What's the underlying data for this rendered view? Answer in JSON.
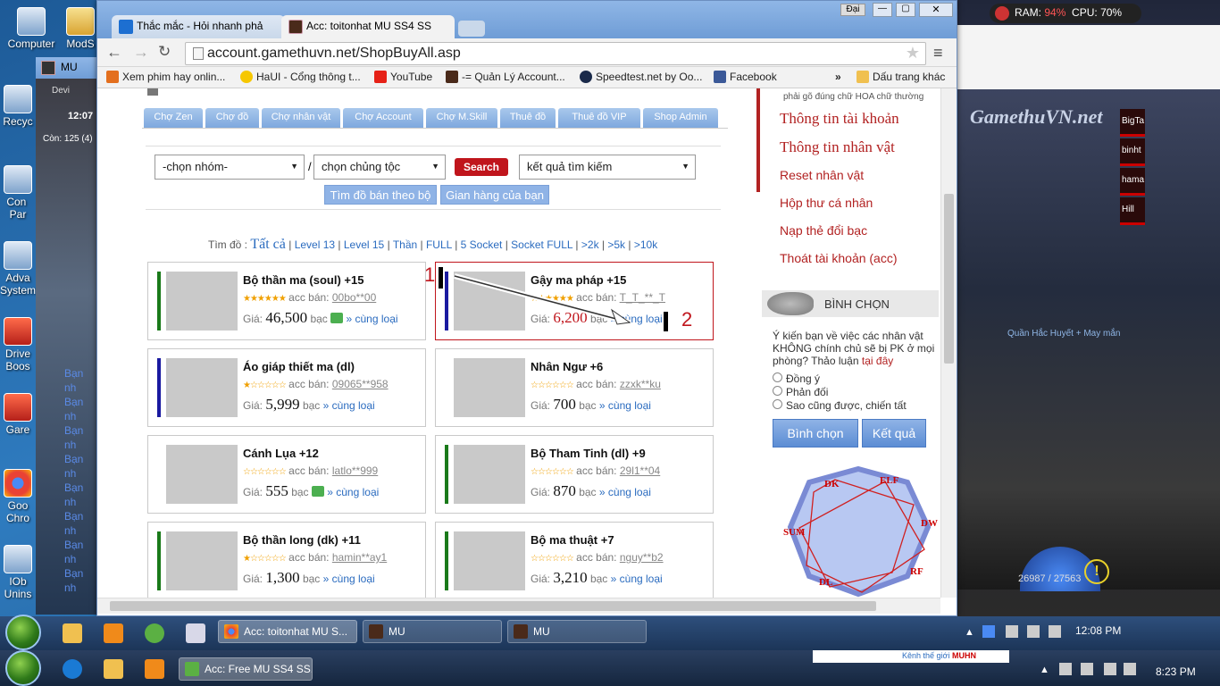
{
  "desktop": {
    "icons": [
      {
        "label": "Computer"
      },
      {
        "label": "ModS"
      },
      {
        "label": "Recyc"
      },
      {
        "label": "Con Par"
      },
      {
        "label": "Adva System"
      },
      {
        "label": "Drive Boos"
      },
      {
        "label": "Gare"
      },
      {
        "label": "Goo Chro"
      },
      {
        "label": "IOb Unins"
      }
    ],
    "left_window": {
      "title": "MU",
      "time": "12:07",
      "count": "Còn: 125 (4)",
      "label": "Devi",
      "chat_lines": [
        "Bạn nh",
        "Bạn nh",
        "Bạn nh",
        "Bạn nh",
        "Bạn nh",
        "Bạn nh",
        "Bạn nh",
        "Bạn nh"
      ]
    },
    "sys_monitor": {
      "ram_label": "RAM:",
      "ram": "94%",
      "cpu_label": "CPU:",
      "cpu": "70%"
    },
    "game": {
      "logo": "GamethuVN.net",
      "names": [
        "BigTa",
        "binht",
        "hama",
        "Hill"
      ],
      "caption": "Quần Hắc Huyết + May mắn",
      "hp": "26987 / 27563"
    }
  },
  "browser": {
    "tabs": [
      {
        "title": "Thắc mắc - Hỏi nhanh phả"
      },
      {
        "title": "Acc: toitonhat MU SS4 SS"
      }
    ],
    "user_badge": "Đại",
    "url": "account.gamethuvn.net/ShopBuyAll.asp",
    "bookmarks": [
      "Xem phim hay onlin...",
      "HaUI - Cổng thông t...",
      "YouTube",
      "-= Quản Lý Account...",
      "Speedtest.net by Oo...",
      "Facebook"
    ],
    "bookmarks_more": "»",
    "bookmarks_folder": "Dấu trang khác"
  },
  "site": {
    "nav": [
      "Chợ Zen",
      "Chợ đồ",
      "Chợ nhân vật",
      "Chợ Account",
      "Chợ M.Skill",
      "Thuê đồ",
      "Thuê đồ VIP",
      "Shop Admin"
    ],
    "filters": {
      "group": "-chọn nhóm-",
      "separator": "/",
      "race": "chọn chủng tộc",
      "search_btn": "Search",
      "result": "kết quả tìm kiếm"
    },
    "buttons": {
      "by_set": "Tìm đồ bán theo bộ",
      "my_shop": "Gian hàng của bạn"
    },
    "find": {
      "label": "Tìm đồ :",
      "all": "Tất cả",
      "links": [
        "Level 13",
        "Level 15",
        "Thần",
        "FULL",
        "5 Socket",
        "Socket FULL",
        ">2k",
        ">5k",
        ">10k"
      ]
    },
    "acc_label": "acc bán:",
    "price_label": "Giá:",
    "currency": "bạc",
    "same_type": "» cùng loại",
    "items": [
      {
        "name": "Bộ thần ma (soul) +15",
        "seller": "00bo**00",
        "price": "46,500",
        "stars": "★★★★★★",
        "stripe": "#1a7a1a",
        "chat": true
      },
      {
        "name": "Gậy ma pháp +15",
        "seller": "T_T_**_T",
        "price": "6,200",
        "stars": "★★★★★★",
        "stripe": "#1a1aa0",
        "highlight": true
      },
      {
        "name": "Áo giáp thiết ma (dl)",
        "seller": "09065**958",
        "price": "5,999",
        "stars": "★☆☆☆☆☆",
        "stripe": "#1a1aa0"
      },
      {
        "name": "Nhân Ngư +6",
        "seller": "zzxk**ku",
        "price": "700",
        "stars": "☆☆☆☆☆☆",
        "stripe": ""
      },
      {
        "name": "Cánh Lụa +12",
        "seller": "latlo**999",
        "price": "555",
        "stars": "☆☆☆☆☆☆",
        "stripe": "",
        "chat": true
      },
      {
        "name": "Bộ Tham Tinh (dl) +9",
        "seller": "29l1**04",
        "price": "870",
        "stars": "☆☆☆☆☆☆",
        "stripe": "#1a7a1a"
      },
      {
        "name": "Bộ thần long (dk) +11",
        "seller": "hamin**ay1",
        "price": "1,300",
        "stars": "★☆☆☆☆☆",
        "stripe": "#1a7a1a"
      },
      {
        "name": "Bộ ma thuật +7",
        "seller": "nguy**b2",
        "price": "3,210",
        "stars": "☆☆☆☆☆☆",
        "stripe": "#1a7a1a"
      }
    ],
    "annotations": {
      "one": "1",
      "two": "2"
    },
    "sidebar": {
      "hint": "phải gõ đúng chữ HOA chữ thường",
      "links": [
        "Thông tin tài khoản",
        "Thông tin nhân vật",
        "Reset nhân vật",
        "Hộp thư cá nhân",
        "Nạp thẻ đổi bạc",
        "Thoát tài khoản (acc)"
      ],
      "poll_title": "BÌNH CHỌN",
      "poll_question": "Ý kiến bạn về việc các nhân vật KHÔNG chính chủ sẽ bị PK ở mọi phòng? Thảo luận",
      "poll_link": "tại đây",
      "options": [
        "Đồng ý",
        "Phản đối",
        "Sao cũng được, chiến tất"
      ],
      "vote_btn": "Bình chọn",
      "result_btn": "Kết quả",
      "diagram_labels": [
        "DK",
        "ELF",
        "DW",
        "RF",
        "DL",
        "SUM"
      ]
    }
  },
  "taskbar": {
    "tasks": [
      "Acc: toitonhat MU S...",
      "MU",
      "MU"
    ],
    "time": "12:08 PM"
  },
  "taskbar2": {
    "tasks": [
      "Acc: Free MU SS4 SS..."
    ],
    "time": "8:23 PM",
    "ad": "Kênh thế giới",
    "ad_brand": "MUHN"
  },
  "colors": {
    "accent": "#2a6bbf",
    "price_red": "#c0151c",
    "link_red": "#b22222",
    "nav": "#7ea8de"
  }
}
